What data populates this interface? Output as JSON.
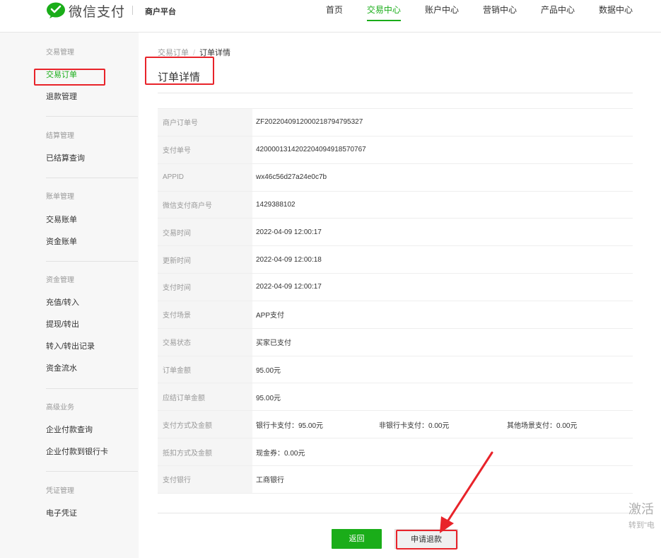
{
  "header": {
    "logo_text": "微信支付",
    "platform": "商户平台",
    "nav": [
      "首页",
      "交易中心",
      "账户中心",
      "营销中心",
      "产品中心",
      "数据中心"
    ],
    "active_nav": "交易中心"
  },
  "sidebar": {
    "groups": [
      {
        "title": "交易管理",
        "items": [
          "交易订单",
          "退款管理"
        ]
      },
      {
        "title": "结算管理",
        "items": [
          "已结算查询"
        ]
      },
      {
        "title": "账单管理",
        "items": [
          "交易账单",
          "资金账单"
        ]
      },
      {
        "title": "资金管理",
        "items": [
          "充值/转入",
          "提现/转出",
          "转入/转出记录",
          "资金流水"
        ]
      },
      {
        "title": "高级业务",
        "items": [
          "企业付款查询",
          "企业付款到银行卡"
        ]
      },
      {
        "title": "凭证管理",
        "items": [
          "电子凭证"
        ]
      }
    ],
    "active_item": "交易订单"
  },
  "breadcrumb": {
    "parent": "交易订单",
    "separator": "/",
    "current": "订单详情"
  },
  "page_title": "订单详情",
  "details": [
    {
      "label": "商户订单号",
      "value": "ZF2022040912000218794795327"
    },
    {
      "label": "支付单号",
      "value": "4200001314202204094918570767"
    },
    {
      "label": "APPID",
      "value": "wx46c56d27a24e0c7b"
    },
    {
      "label": "微信支付商户号",
      "value": "1429388102"
    },
    {
      "label": "交易时间",
      "value": "2022-04-09 12:00:17"
    },
    {
      "label": "更新时间",
      "value": "2022-04-09 12:00:18"
    },
    {
      "label": "支付时间",
      "value": "2022-04-09 12:00:17"
    },
    {
      "label": "支付场景",
      "value": "APP支付"
    },
    {
      "label": "交易状态",
      "value": "买家已支付"
    },
    {
      "label": "订单金额",
      "value": "95.00元"
    },
    {
      "label": "应结订单金额",
      "value": "95.00元"
    },
    {
      "label": "支付方式及金额",
      "values": [
        "银行卡支付：95.00元",
        "非银行卡支付：0.00元",
        "其他场景支付：0.00元"
      ]
    },
    {
      "label": "抵扣方式及金额",
      "value": "现金券：0.00元"
    },
    {
      "label": "支付银行",
      "value": "工商银行"
    }
  ],
  "buttons": {
    "back": "返回",
    "refund": "申请退款"
  },
  "watermark": {
    "line1": "激活",
    "line2": "转到\"电"
  },
  "colors": {
    "brand": "#1aad19",
    "annotation": "#e8232a"
  }
}
